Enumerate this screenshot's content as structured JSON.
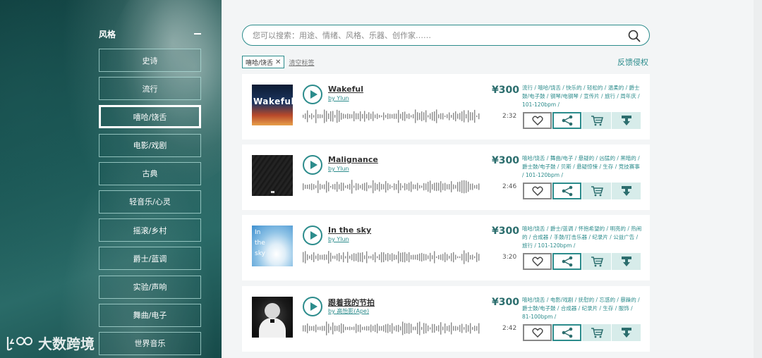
{
  "sidebar": {
    "section_title": "风格",
    "genres": [
      {
        "label": "史诗",
        "active": false
      },
      {
        "label": "流行",
        "active": false
      },
      {
        "label": "嘻哈/饶舌",
        "active": true
      },
      {
        "label": "电影/戏剧",
        "active": false
      },
      {
        "label": "古典",
        "active": false
      },
      {
        "label": "轻音乐/心灵",
        "active": false
      },
      {
        "label": "摇滚/乡村",
        "active": false
      },
      {
        "label": "爵士/蓝调",
        "active": false
      },
      {
        "label": "实验/声响",
        "active": false
      },
      {
        "label": "舞曲/电子",
        "active": false
      },
      {
        "label": "世界音乐",
        "active": false
      }
    ],
    "watermark_text": "大数跨境"
  },
  "search": {
    "placeholder": "您可以搜索：用途、情绪、风格、乐器、创作家……"
  },
  "filters": {
    "active_tag": "嘻哈/饶舌",
    "clear_label": "清空标签",
    "feedback_label": "反馈侵权"
  },
  "tracks": [
    {
      "title": "Wakeful",
      "artist": "by Ylun",
      "cover_text": "Wakeful",
      "price": "¥300",
      "duration": "2:32",
      "tags": "流行 / 嘻哈/饶舌 / 快乐的 / 轻松的 / 温柔的 / 爵士鼓/电子鼓 / 钢琴/电钢琴 / 宣传片 / 旅行 / 周年庆 / 101-120bpm /"
    },
    {
      "title": "Malignance",
      "artist": "by Ylun",
      "cover_text": "",
      "price": "¥300",
      "duration": "2:46",
      "tags": "嘻哈/饶舌 / 舞曲/电子 / 悬疑的 / 凶猛的 / 黑暗的 / 爵士鼓/电子鼓 / 贝斯 / 悬疑惊悚 / 生存 / 竞技赛事 / 101-120bpm /"
    },
    {
      "title": "In the sky",
      "artist": "by Ylun",
      "cover_text": "In the sky",
      "price": "¥300",
      "duration": "3:20",
      "tags": "嘻哈/饶舌 / 爵士/蓝调 / 怀抱希望的 / 明亮的 / 热闹的 / 合成器 / 手鼓/打击乐器 / 纪录片 / 公益广告 / 旅行 / 101-120bpm /"
    },
    {
      "title": "跟着我的节拍",
      "artist": "by 高怡影(Ape)",
      "cover_text": "",
      "price": "¥300",
      "duration": "2:42",
      "tags": "嘻哈/饶舌 / 电影/戏剧 / 抚慰的 / 忘惑的 / 暴躁的 / 爵士鼓/电子鼓 / 合成器 / 纪录片 / 生存 / 服饰 / 81-100bpm /"
    }
  ],
  "colors": {
    "accent": "#2c8c8c",
    "price": "#2c6e6e",
    "action_fill": "#d7ecea"
  },
  "icons": {
    "search": "search-icon",
    "play": "play-icon",
    "favorite": "heart-icon",
    "share": "share-icon",
    "cart": "cart-icon",
    "download": "download-icon",
    "collapse": "minus-icon",
    "remove_tag": "close-icon"
  }
}
